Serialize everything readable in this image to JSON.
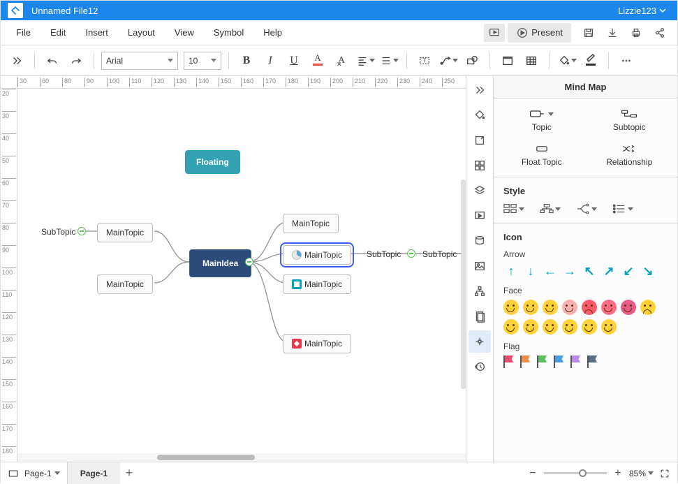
{
  "titlebar": {
    "filename": "Unnamed File12",
    "user": "Lizzie123"
  },
  "menu": [
    "File",
    "Edit",
    "Insert",
    "Layout",
    "View",
    "Symbol",
    "Help"
  ],
  "menubar": {
    "present_label": "Present"
  },
  "toolbar": {
    "font": "Arial",
    "size": "10"
  },
  "ruler_h": [
    30,
    60,
    80,
    90,
    100,
    110,
    120,
    130,
    140,
    150,
    160,
    170,
    180,
    190,
    200,
    210,
    220,
    230,
    240,
    250
  ],
  "ruler_v": [
    20,
    30,
    40,
    50,
    60,
    70,
    80,
    90,
    100,
    110,
    120,
    130,
    140,
    150,
    160,
    170,
    180
  ],
  "mindmap": {
    "center": "MainIdea",
    "floating": "Floating",
    "left": {
      "sub": "SubTopic",
      "topics": [
        "MainTopic",
        "MainTopic"
      ]
    },
    "right": {
      "topics": [
        "MainTopic",
        "MainTopic",
        "MainTopic",
        "MainTopic"
      ],
      "selected_index": 1,
      "subs": [
        "SubTopic",
        "SubTopic"
      ]
    }
  },
  "panel": {
    "title": "Mind Map",
    "buttons": {
      "topic": "Topic",
      "subtopic": "Subtopic",
      "float": "Float Topic",
      "rel": "Relationship"
    },
    "style_h": "Style",
    "icon_h": "Icon",
    "groups": {
      "arrow": "Arrow",
      "face": "Face",
      "flag": "Flag"
    },
    "flag_colors": [
      "#e84a6b",
      "#f09048",
      "#5bbf5b",
      "#4a9be8",
      "#b98be8",
      "#5a6b8a"
    ],
    "face_colors": [
      "#ffd23a",
      "#ffd23a",
      "#ffd23a",
      "#ffb1b1",
      "#ff5a6b",
      "#ff6b86",
      "#e85a8a",
      "#ffd23a",
      "#ffd23a",
      "#ffd23a",
      "#ffd23a",
      "#ffd23a",
      "#ffd23a",
      "#ffd23a"
    ]
  },
  "status": {
    "page_sel": "Page-1",
    "active_tab": "Page-1",
    "zoom_pct": "85%"
  }
}
